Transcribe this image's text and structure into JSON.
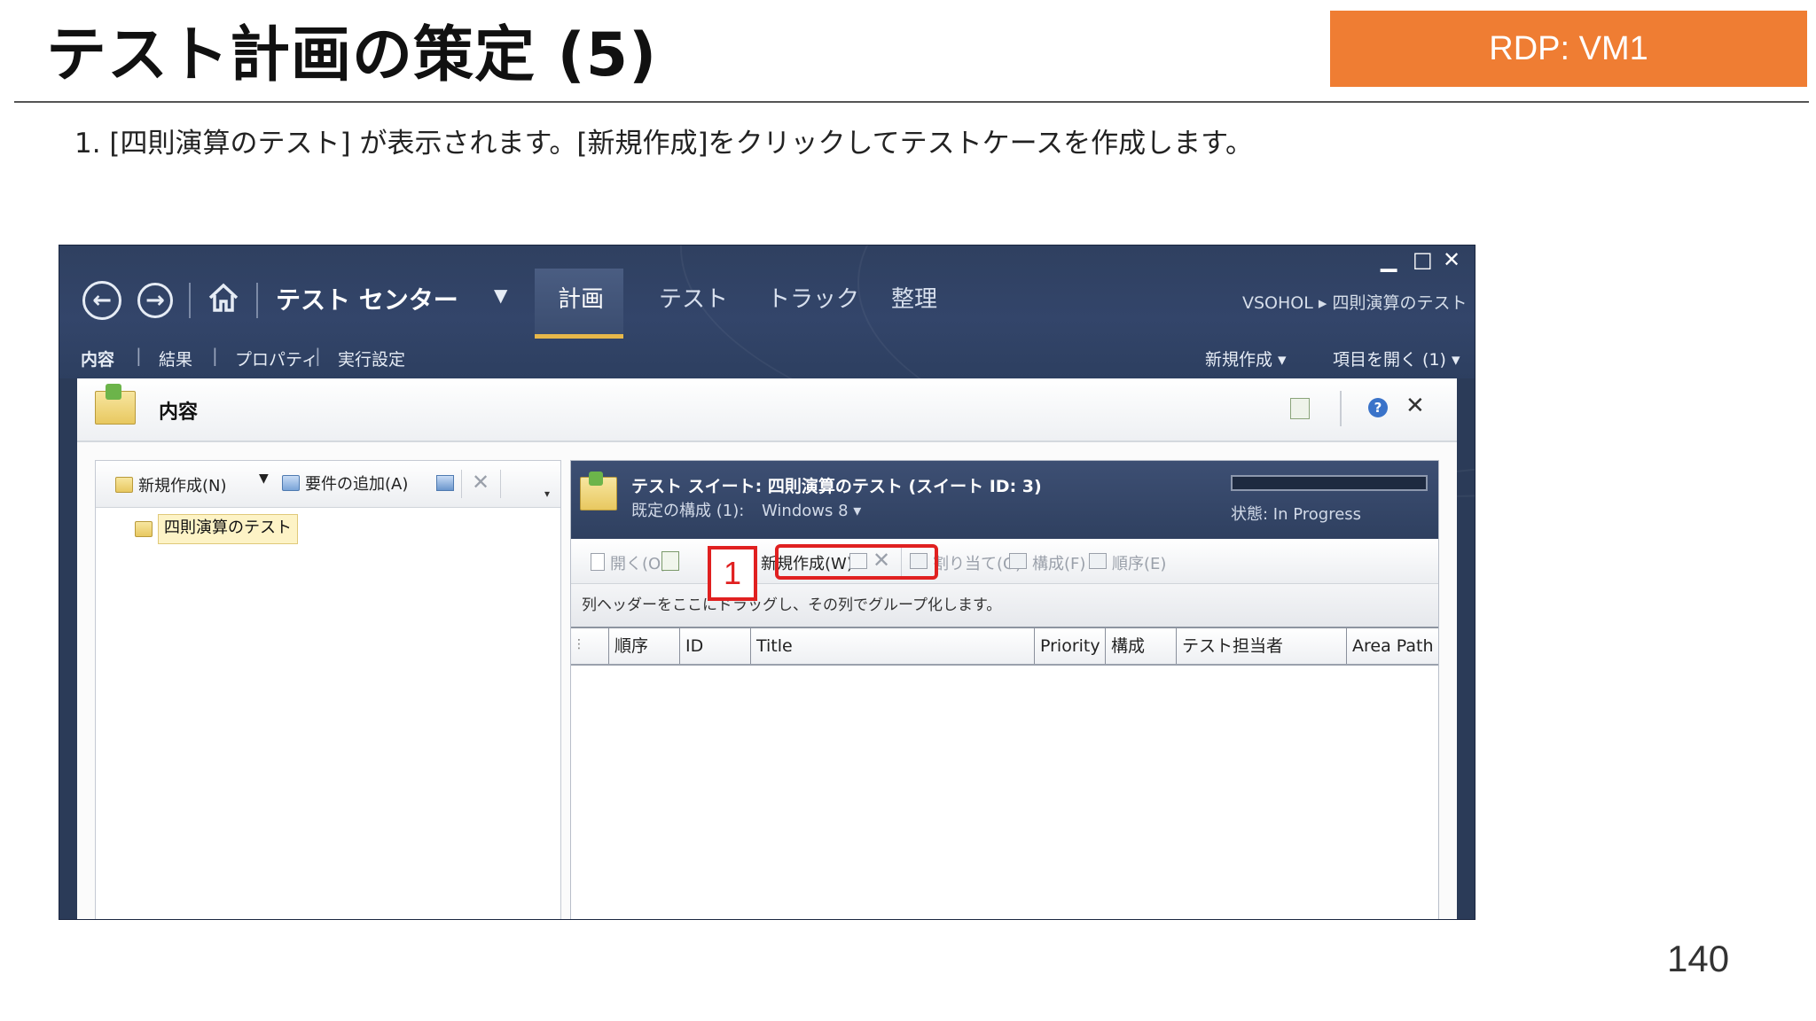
{
  "slide": {
    "title": "テスト計画の策定 (5)",
    "rdp_badge": "RDP: VM1",
    "instruction": "1.  [四則演算のテスト] が表示されます。[新規作成]をクリックしてテストケースを作成します。",
    "page_number": "140"
  },
  "window": {
    "app_title": "テスト センター",
    "tabs": [
      {
        "label": "計画"
      },
      {
        "label": "テスト"
      },
      {
        "label": "トラック"
      },
      {
        "label": "整理"
      }
    ],
    "breadcrumb": "VSOHOL ▸ 四則演算のテスト",
    "subnav": [
      {
        "label": "内容"
      },
      {
        "label": "結果"
      },
      {
        "label": "プロパティ"
      },
      {
        "label": "実行設定"
      }
    ],
    "right_menu": {
      "new": "新規作成 ▾",
      "open_item": "項目を開く (1) ▾"
    }
  },
  "content": {
    "title": "内容",
    "left_toolbar": {
      "new": "新規作成(N)",
      "add_requirement": "要件の追加(A)"
    },
    "tree_item": "四則演算のテスト",
    "suite": {
      "title": "テスト スイート:  四則演算のテスト (スイート ID: 3)",
      "config_label": "既定の構成 (1):",
      "config_value": "Windows 8 ▾",
      "status": "状態: In Progress",
      "progress": 0
    },
    "case_toolbar": {
      "open": "開く(O)",
      "new": "新規作成(W)",
      "assign": "割り当て(G)",
      "configure": "構成(F)",
      "order": "順序(E)"
    },
    "group_hint": "列ヘッダーをここにドラッグし、その列でグループ化します。",
    "columns": [
      "順序",
      "ID",
      "Title",
      "Priority",
      "構成",
      "テスト担当者",
      "Area Path"
    ],
    "step_callout": "1"
  }
}
